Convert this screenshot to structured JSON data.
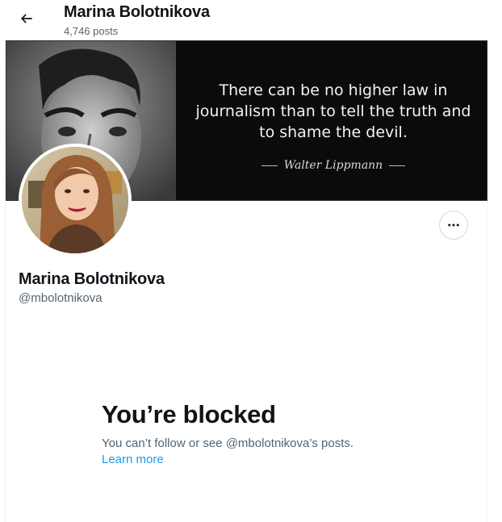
{
  "header": {
    "back_icon": "arrow-left-icon",
    "name": "Marina Bolotnikova",
    "post_count": "4,746 posts"
  },
  "banner": {
    "quote": "There can be no higher law in journalism than to tell the truth and to shame the devil.",
    "author": "Walter Lippmann"
  },
  "profile": {
    "name": "Marina Bolotnikova",
    "handle": "@mbolotnikova",
    "more_icon": "more-dots-icon"
  },
  "blocked": {
    "title": "You’re blocked",
    "description": "You can’t follow or see @mbolotnikova’s posts.",
    "learn_more": "Learn more"
  },
  "colors": {
    "text_primary": "#0f1419",
    "text_secondary": "#536471",
    "link": "#1d9bf0",
    "border": "#cfd9de"
  }
}
